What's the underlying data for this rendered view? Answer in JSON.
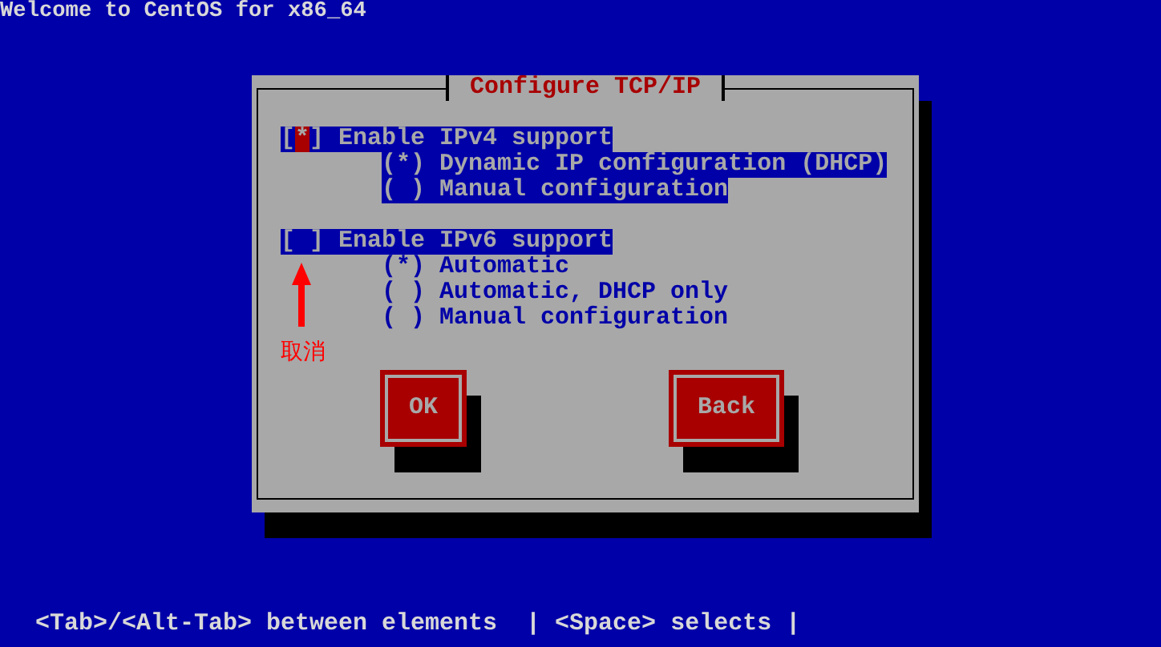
{
  "title": "Welcome to CentOS for x86_64",
  "glyphs": {
    "box_open": "[",
    "box_close": "]",
    "radio_open": "(",
    "radio_close": ")",
    "mark": "*"
  },
  "dialog": {
    "title": "Configure TCP/IP",
    "sections": [
      {
        "label": "Enable IPv4 support",
        "checked": true,
        "focused": true,
        "options": [
          {
            "label": "Dynamic IP configuration (DHCP)",
            "selected": true,
            "disabled": false
          },
          {
            "label": "Manual configuration",
            "selected": false,
            "disabled": false
          }
        ]
      },
      {
        "label": "Enable IPv6 support",
        "checked": false,
        "focused": false,
        "options": [
          {
            "label": "Automatic",
            "selected": true,
            "disabled": true
          },
          {
            "label": "Automatic, DHCP only",
            "selected": false,
            "disabled": true
          },
          {
            "label": "Manual configuration",
            "selected": false,
            "disabled": true
          }
        ]
      }
    ],
    "annotation": {
      "text": "取消"
    },
    "buttons": [
      "OK",
      "Back"
    ]
  },
  "status_bar": "<Tab>/<Alt-Tab> between elements  | <Space> selects |"
}
